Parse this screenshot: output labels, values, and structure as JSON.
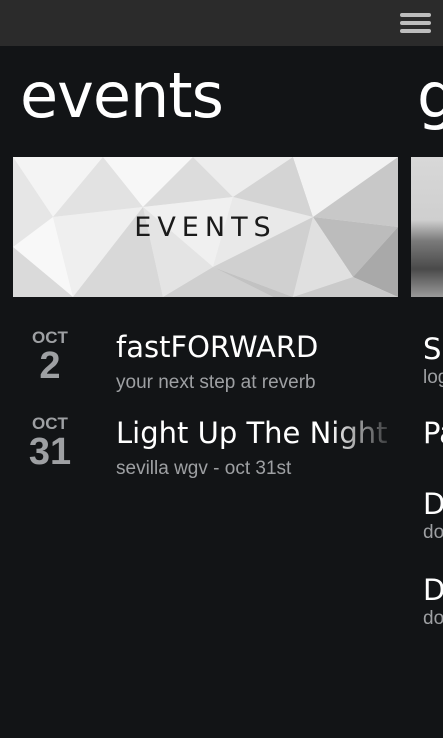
{
  "menu_icon": "hamburger-menu-icon",
  "panels": {
    "main_title": "events",
    "next_title": "g"
  },
  "banner": {
    "text": "EVENTS"
  },
  "events": [
    {
      "month": "OCT",
      "day": "2",
      "title": "fastFORWARD",
      "subtitle": "your next step at reverb"
    },
    {
      "month": "OCT",
      "day": "31",
      "title": "Light Up The Night",
      "subtitle": "sevilla wgv - oct 31st"
    }
  ],
  "peek_items": [
    {
      "title": "Se",
      "subtitle": "log"
    },
    {
      "title": "Pa",
      "subtitle": ""
    },
    {
      "title": "D",
      "subtitle": "do"
    },
    {
      "title": "D",
      "subtitle": "do"
    }
  ]
}
